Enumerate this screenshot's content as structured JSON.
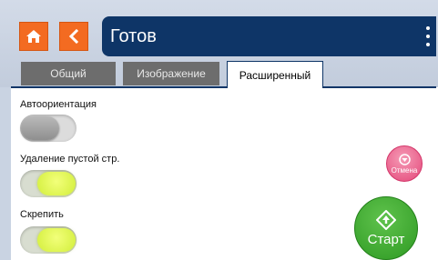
{
  "header": {
    "title": "Готов",
    "home_icon": "home-icon",
    "back_icon": "chevron-left-icon",
    "menu_icon": "kebab-menu-icon",
    "accent_color": "#f36b21",
    "bar_color": "#0e3567"
  },
  "tabs": [
    {
      "label": "Общий",
      "active": false
    },
    {
      "label": "Изображение",
      "active": false
    },
    {
      "label": "Расширенный",
      "active": true
    }
  ],
  "options": [
    {
      "label": "Автоориентация",
      "state": "off"
    },
    {
      "label": "Удаление пустой стр.",
      "state": "on"
    },
    {
      "label": "Скрепить",
      "state": "on"
    }
  ],
  "actions": {
    "cancel_label": "Отмена",
    "start_label": "Старт",
    "cancel_color": "#e4487a",
    "start_color": "#2e9a23"
  }
}
